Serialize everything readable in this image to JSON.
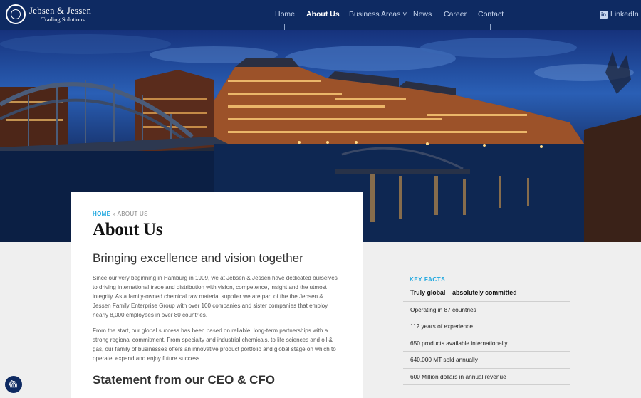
{
  "header": {
    "brand": {
      "name": "Jebsen & Jessen",
      "tagline": "Trading Solutions"
    },
    "nav": [
      {
        "label": "Home",
        "active": false
      },
      {
        "label": "About Us",
        "active": true
      },
      {
        "label": "Business Areas ˅",
        "active": false
      },
      {
        "label": "News",
        "active": false
      },
      {
        "label": "Career",
        "active": false
      },
      {
        "label": "Contact",
        "active": false
      }
    ],
    "linkedin": {
      "icon": "in",
      "label": "LinkedIn"
    }
  },
  "breadcrumb": {
    "home": "HOME",
    "separator": " » ",
    "current": "ABOUT US"
  },
  "page": {
    "title": "About Us",
    "lead": "Bringing excellence and vision together",
    "paragraphs": [
      "Since our very beginning in Hamburg in 1909, we at Jebsen & Jessen have dedicated ourselves to driving international trade and distribution with vision, competence, insight and the utmost integrity. As a family-owned chemical raw material supplier we are part of the the Jebsen & Jessen Family Enterprise Group with over 100 companies and sister companies that employ nearly 8,000 employees in over 80 countries.",
      "From the start, our global success has been based on reliable, long-term partnerships with a strong regional commitment. From specialty and industrial chemicals, to life sciences and oil & gas, our family of businesses offers an innovative product portfolio and global stage on which to operate, expand and enjoy future success"
    ],
    "subheading": "Statement from our CEO & CFO"
  },
  "key_facts": {
    "label": "KEY FACTS",
    "headline": "Truly global – absolutely committed",
    "items": [
      "Operating in 87 countries",
      "112 years of experience",
      "650 products available internationally",
      "640,000 MT sold annually",
      "600 Million dollars in annual revenue"
    ]
  },
  "colors": {
    "navy": "#0e2a62",
    "accent": "#1ea7df",
    "page_bg": "#efefef"
  },
  "icons": {
    "logo": "company-crest-icon",
    "linkedin": "linkedin-icon",
    "badge": "fingerprint-icon"
  }
}
